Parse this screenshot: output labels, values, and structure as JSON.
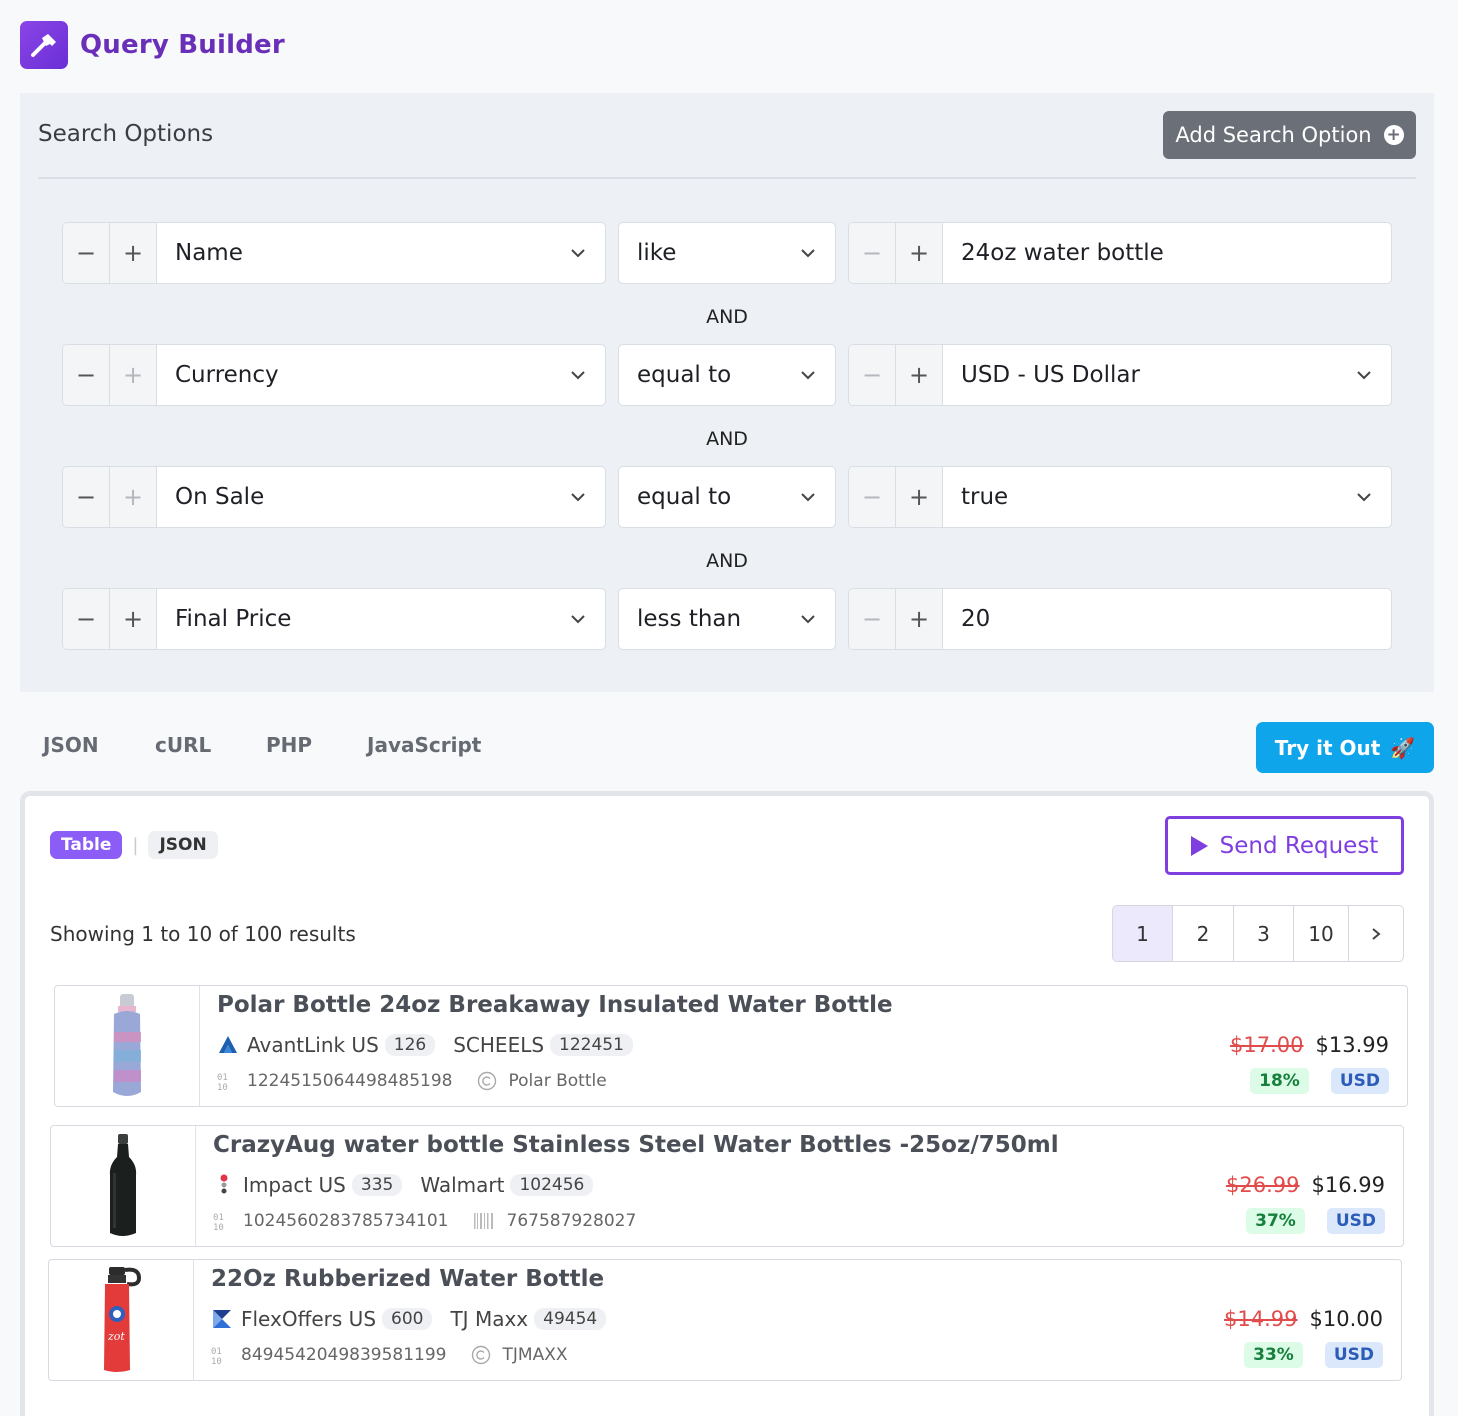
{
  "app": {
    "title": "Query Builder"
  },
  "search_options": {
    "title": "Search Options",
    "add_button_label": "Add Search Option",
    "rows": [
      {
        "field": "Name",
        "operator": "like",
        "value": "24oz water bottle"
      },
      {
        "field": "Currency",
        "operator": "equal to",
        "value": "USD - US Dollar"
      },
      {
        "field": "On Sale",
        "operator": "equal to",
        "value": "true"
      },
      {
        "field": "Final Price",
        "operator": "less than",
        "value": "20"
      }
    ],
    "connector": "AND"
  },
  "code_tabs": [
    "JSON",
    "cURL",
    "PHP",
    "JavaScript"
  ],
  "try_button": {
    "label": "Try it Out",
    "icon": "🚀"
  },
  "results": {
    "view_toggle": {
      "table": "Table",
      "json": "JSON"
    },
    "send_button": "Send Request",
    "showing": "Showing 1 to 10 of 100 results",
    "pages": [
      "1",
      "2",
      "3",
      "10"
    ],
    "products": [
      {
        "title": "Polar Bottle 24oz Breakaway Insulated Water Bottle",
        "network": "AvantLink US",
        "network_count": "126",
        "merchant": "SCHEELS",
        "merchant_count": "122451",
        "id": "1224515064498485198",
        "brand": "Polar Bottle",
        "brand_icon": "copyright-icon",
        "old_price": "$17.00",
        "price": "$13.99",
        "discount": "18%",
        "currency": "USD"
      },
      {
        "title": "CrazyAug water bottle Stainless Steel Water Bottles -25oz/750ml",
        "network": "Impact US",
        "network_count": "335",
        "merchant": "Walmart",
        "merchant_count": "102456",
        "id": "1024560283785734101",
        "brand": "767587928027",
        "brand_icon": "barcode-icon",
        "old_price": "$26.99",
        "price": "$16.99",
        "discount": "37%",
        "currency": "USD"
      },
      {
        "title": "22Oz Rubberized Water Bottle",
        "network": "FlexOffers US",
        "network_count": "600",
        "merchant": "TJ Maxx",
        "merchant_count": "49454",
        "id": "8494542049839581199",
        "brand": "TJMAXX",
        "brand_icon": "copyright-icon",
        "old_price": "$14.99",
        "price": "$10.00",
        "discount": "33%",
        "currency": "USD"
      }
    ]
  }
}
